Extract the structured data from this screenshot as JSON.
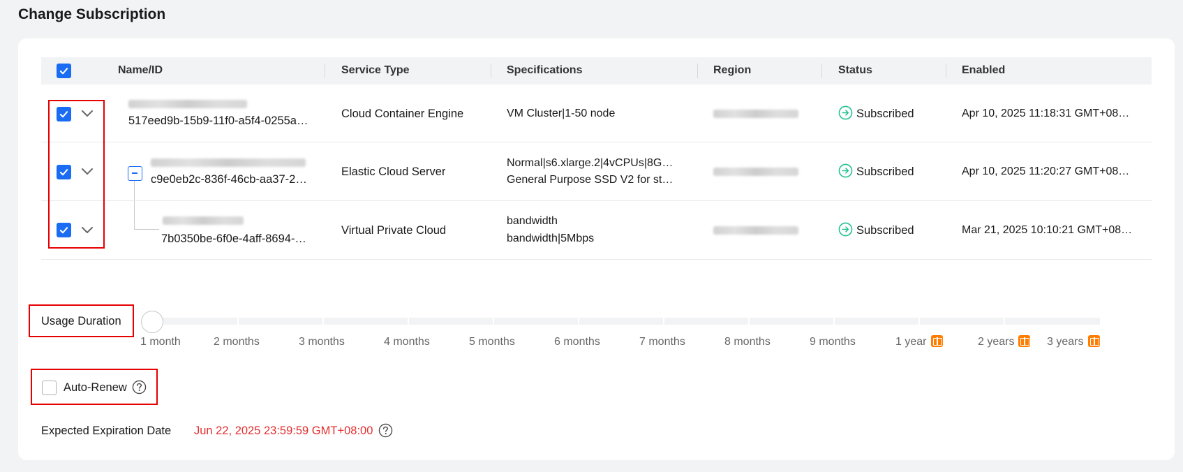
{
  "page": {
    "title": "Change Subscription"
  },
  "table": {
    "headers": {
      "name_id": "Name/ID",
      "service_type": "Service Type",
      "specifications": "Specifications",
      "region": "Region",
      "status": "Status",
      "enabled": "Enabled"
    },
    "rows": [
      {
        "id": "517eed9b-15b9-11f0-a5f4-0255a…",
        "service_type": "Cloud Container Engine",
        "spec_line1": "VM Cluster|1-50 node",
        "spec_line2": "",
        "status": "Subscribed",
        "enabled": "Apr 10, 2025 11:18:31 GMT+08…"
      },
      {
        "id": "c9e0eb2c-836f-46cb-aa37-2…",
        "service_type": "Elastic Cloud Server",
        "spec_line1": "Normal|s6.xlarge.2|4vCPUs|8G…",
        "spec_line2": "General Purpose SSD V2 for st…",
        "status": "Subscribed",
        "enabled": "Apr 10, 2025 11:20:27 GMT+08…"
      },
      {
        "id": "7b0350be-6f0e-4aff-8694-…",
        "service_type": "Virtual Private Cloud",
        "spec_line1": "bandwidth",
        "spec_line2": "bandwidth|5Mbps",
        "status": "Subscribed",
        "enabled": "Mar 21, 2025 10:10:21 GMT+08…"
      }
    ]
  },
  "usage_duration": {
    "label": "Usage Duration",
    "selected_index": 0,
    "options": [
      "1 month",
      "2 months",
      "3 months",
      "4 months",
      "5 months",
      "6 months",
      "7 months",
      "8 months",
      "9 months",
      "1 year",
      "2 years",
      "3 years"
    ]
  },
  "auto_renew": {
    "label": "Auto-Renew",
    "checked": false
  },
  "expiration": {
    "label": "Expected Expiration Date",
    "value": "Jun 22, 2025 23:59:59 GMT+08:00"
  },
  "colors": {
    "primary": "#1a6cf2",
    "status_green": "#1fbe92",
    "expiration_red": "#e52e2e",
    "highlight_red": "#e60000",
    "gift_orange": "#ff7d00"
  }
}
